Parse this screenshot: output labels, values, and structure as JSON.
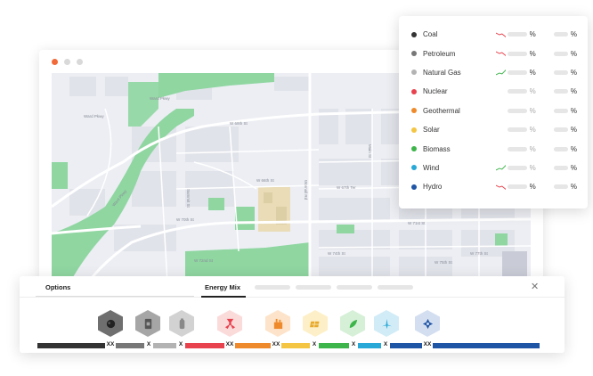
{
  "browser": {
    "controls": [
      "close",
      "minimize",
      "maximize"
    ]
  },
  "map": {
    "street_labels": [
      "Ward Pkwy",
      "Ward Pkwy",
      "W 66th St",
      "W 67th Ter",
      "W 70th St",
      "W 71st St",
      "W 72nd St",
      "W 74th St",
      "W 75th St",
      "Ward Pkwy",
      "Wornall Rd",
      "W 69th St",
      "Summit St",
      "W 77th St",
      "Main St"
    ]
  },
  "legend": {
    "items": [
      {
        "name": "Coal",
        "color": "#333333",
        "trend": "down",
        "pct": "%",
        "pct2": "%"
      },
      {
        "name": "Petroleum",
        "color": "#777777",
        "trend": "down",
        "pct": "%",
        "pct2": "%"
      },
      {
        "name": "Natural Gas",
        "color": "#b3b3b3",
        "trend": "up",
        "pct": "%",
        "pct2": "%"
      },
      {
        "name": "Nuclear",
        "color": "#e8424e",
        "trend": "",
        "pct": "%",
        "pct2": "%"
      },
      {
        "name": "Geothermal",
        "color": "#ef8a2c",
        "trend": "",
        "pct": "%",
        "pct2": "%"
      },
      {
        "name": "Solar",
        "color": "#f4c542",
        "trend": "",
        "pct": "%",
        "pct2": "%"
      },
      {
        "name": "Biomass",
        "color": "#3db54a",
        "trend": "",
        "pct": "%",
        "pct2": "%"
      },
      {
        "name": "Wind",
        "color": "#28a8d6",
        "trend": "up",
        "pct": "%",
        "pct2": "%"
      },
      {
        "name": "Hydro",
        "color": "#1f55a5",
        "trend": "down",
        "pct": "%",
        "pct2": "%"
      }
    ]
  },
  "panel": {
    "tab_options": "Options",
    "tab_energy_mix": "Energy Mix",
    "close_icon": "close-icon",
    "sources": [
      {
        "icon": "coal-icon",
        "color": "#555555",
        "bg": "#6f6f6f"
      },
      {
        "icon": "petroleum-icon",
        "color": "#666666",
        "bg": "#a6a6a6"
      },
      {
        "icon": "natural-gas-icon",
        "color": "#888888",
        "bg": "#d2d2d2"
      },
      {
        "icon": "nuclear-icon",
        "color": "#e8424e",
        "bg": "#fbdada"
      },
      {
        "icon": "geothermal-icon",
        "color": "#ef8a2c",
        "bg": "#fde3c9"
      },
      {
        "icon": "solar-icon",
        "color": "#e7a92a",
        "bg": "#fdf0c8"
      },
      {
        "icon": "biomass-icon",
        "color": "#3db54a",
        "bg": "#d6f0d8"
      },
      {
        "icon": "wind-icon",
        "color": "#28a8d6",
        "bg": "#d1ecf6"
      },
      {
        "icon": "hydro-icon",
        "color": "#1f55a5",
        "bg": "#d3def0"
      }
    ],
    "bars": [
      {
        "color": "#333333",
        "label": "XX"
      },
      {
        "color": "#777777",
        "label": "X"
      },
      {
        "color": "#b3b3b3",
        "label": "X"
      },
      {
        "color": "#e8424e",
        "label": "XX"
      },
      {
        "color": "#ef8a2c",
        "label": "XX"
      },
      {
        "color": "#f4c542",
        "label": "X"
      },
      {
        "color": "#3db54a",
        "label": "X"
      },
      {
        "color": "#28a8d6",
        "label": "X"
      },
      {
        "color": "#1f55a5",
        "label": "XX"
      }
    ]
  }
}
